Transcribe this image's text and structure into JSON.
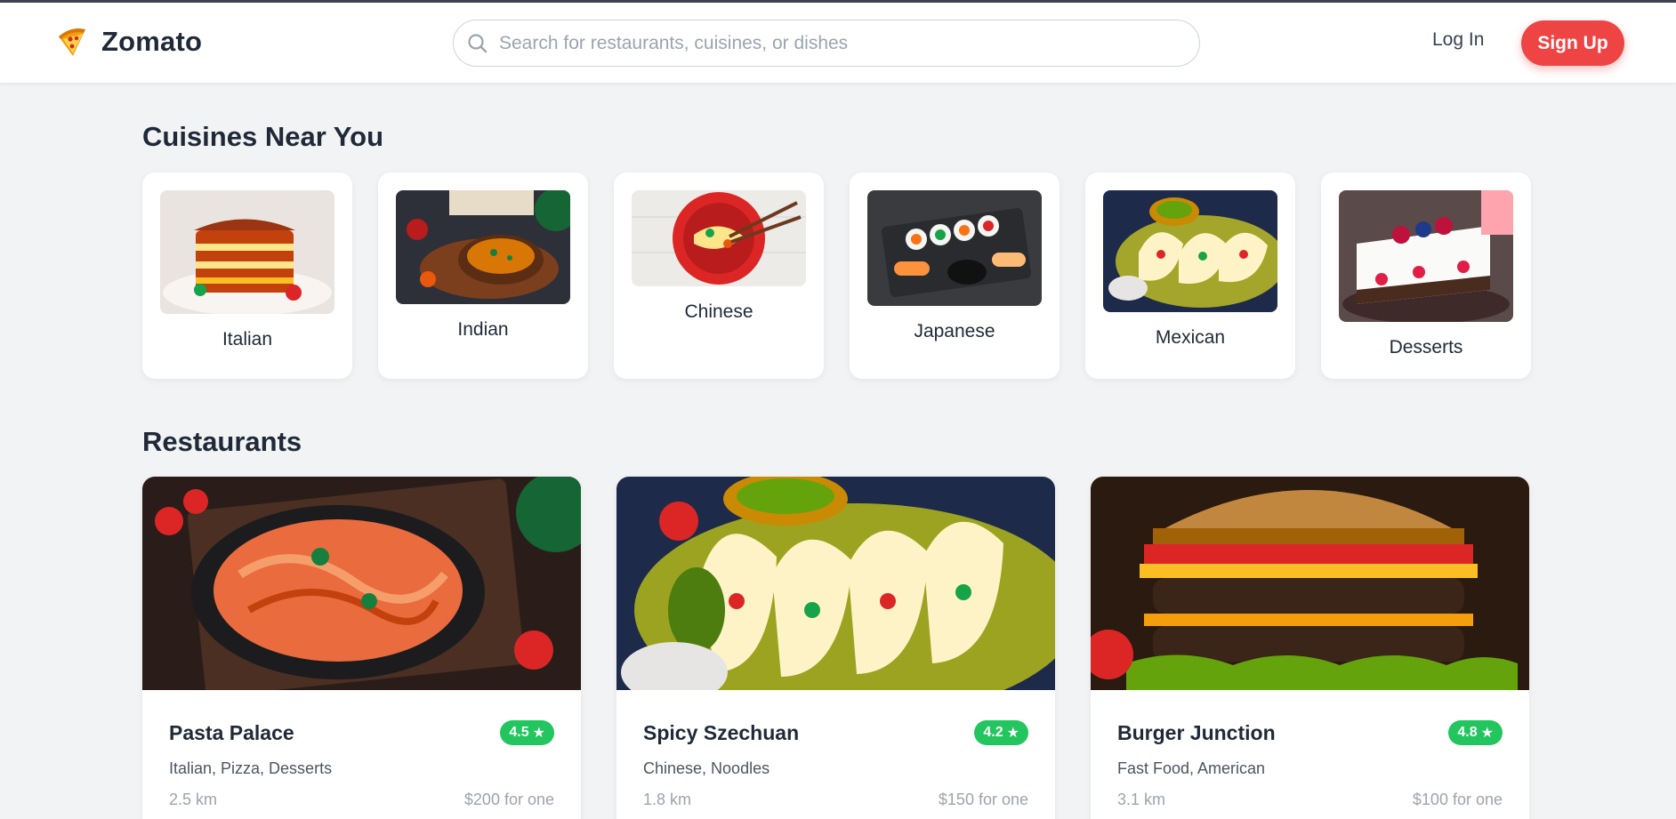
{
  "app": {
    "brand_name": "Zomato",
    "brand_icon": "pizza-slice-icon",
    "accent_color": "#ef4444"
  },
  "header": {
    "search_placeholder": "Search for restaurants, cuisines, or dishes",
    "search_value": "",
    "login_label": "Log In",
    "signup_label": "Sign Up"
  },
  "cuisines_section": {
    "title": "Cuisines Near You",
    "items": [
      {
        "label": "Italian",
        "image": "lasagna-photo"
      },
      {
        "label": "Indian",
        "image": "curry-bowl-photo"
      },
      {
        "label": "Chinese",
        "image": "noodle-bowl-photo"
      },
      {
        "label": "Japanese",
        "image": "sushi-platter-photo"
      },
      {
        "label": "Mexican",
        "image": "tacos-plate-photo"
      },
      {
        "label": "Desserts",
        "image": "berry-cheesecake-photo"
      }
    ]
  },
  "restaurants_section": {
    "title": "Restaurants",
    "items": [
      {
        "name": "Pasta Palace",
        "rating": "4.5",
        "tags": "Italian, Pizza, Desserts",
        "distance": "2.5 km",
        "price": "$200 for one",
        "image": "pasta-dish-photo"
      },
      {
        "name": "Spicy Szechuan",
        "rating": "4.2",
        "tags": "Chinese, Noodles",
        "distance": "1.8 km",
        "price": "$150 for one",
        "image": "tacos-photo"
      },
      {
        "name": "Burger Junction",
        "rating": "4.8",
        "tags": "Fast Food, American",
        "distance": "3.1 km",
        "price": "$100 for one",
        "image": "burger-photo"
      }
    ],
    "rating_color": "#22c55e"
  }
}
